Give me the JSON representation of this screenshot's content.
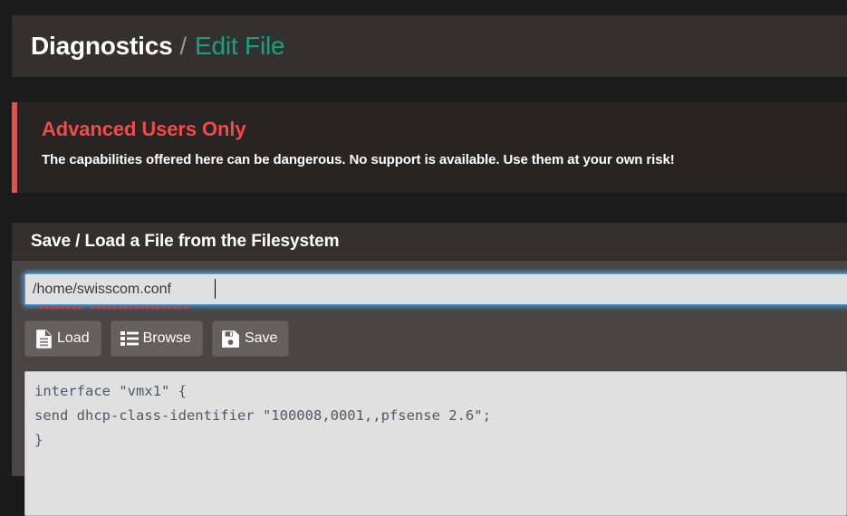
{
  "breadcrumb": {
    "root": "Diagnostics",
    "separator": "/",
    "current": "Edit File"
  },
  "alert": {
    "title": "Advanced Users Only",
    "message": "The capabilities offered here can be dangerous. No support is available. Use them at your own risk!",
    "accent_color": "#e05252",
    "title_color": "#ef4b4b"
  },
  "panel": {
    "title": "Save / Load a File from the Filesystem",
    "path_field": {
      "value": "/home/swisscom.conf",
      "placeholder": "",
      "focused": true
    },
    "buttons": [
      {
        "label": "Load",
        "icon": "file-text-icon"
      },
      {
        "label": "Browse",
        "icon": "list-ul-icon"
      },
      {
        "label": "Save",
        "icon": "floppy-save-icon"
      }
    ],
    "editor": {
      "content": "interface \"vmx1\" {\nsend dhcp-class-identifier \"100008,0001,,pfsense 2.6\";\n}"
    }
  },
  "theme": {
    "page_background": "#1c1b1b",
    "bar_background": "#333130",
    "alert_background": "#262524",
    "panel_background": "#474443",
    "link_color": "#15a37f",
    "field_background": "#e0e0e0",
    "focus_glow": "#5a9fd4"
  }
}
